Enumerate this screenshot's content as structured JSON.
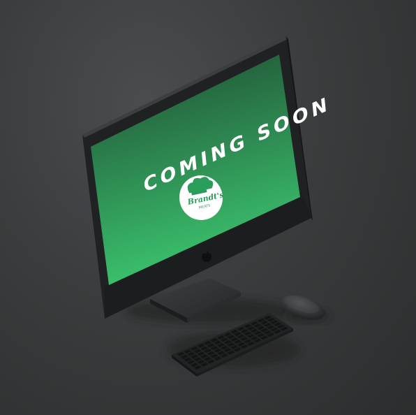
{
  "screen": {
    "headline": "COMING SOON",
    "gradient_top": "#1f4a32",
    "gradient_bottom": "#3bc46e"
  },
  "logo": {
    "text": "Brandt's",
    "subtext": "MEATS",
    "badge_color": "#ffffff",
    "accent_color": "#2a9d5a"
  },
  "device": {
    "brand_icon": "apple-logo-icon"
  }
}
